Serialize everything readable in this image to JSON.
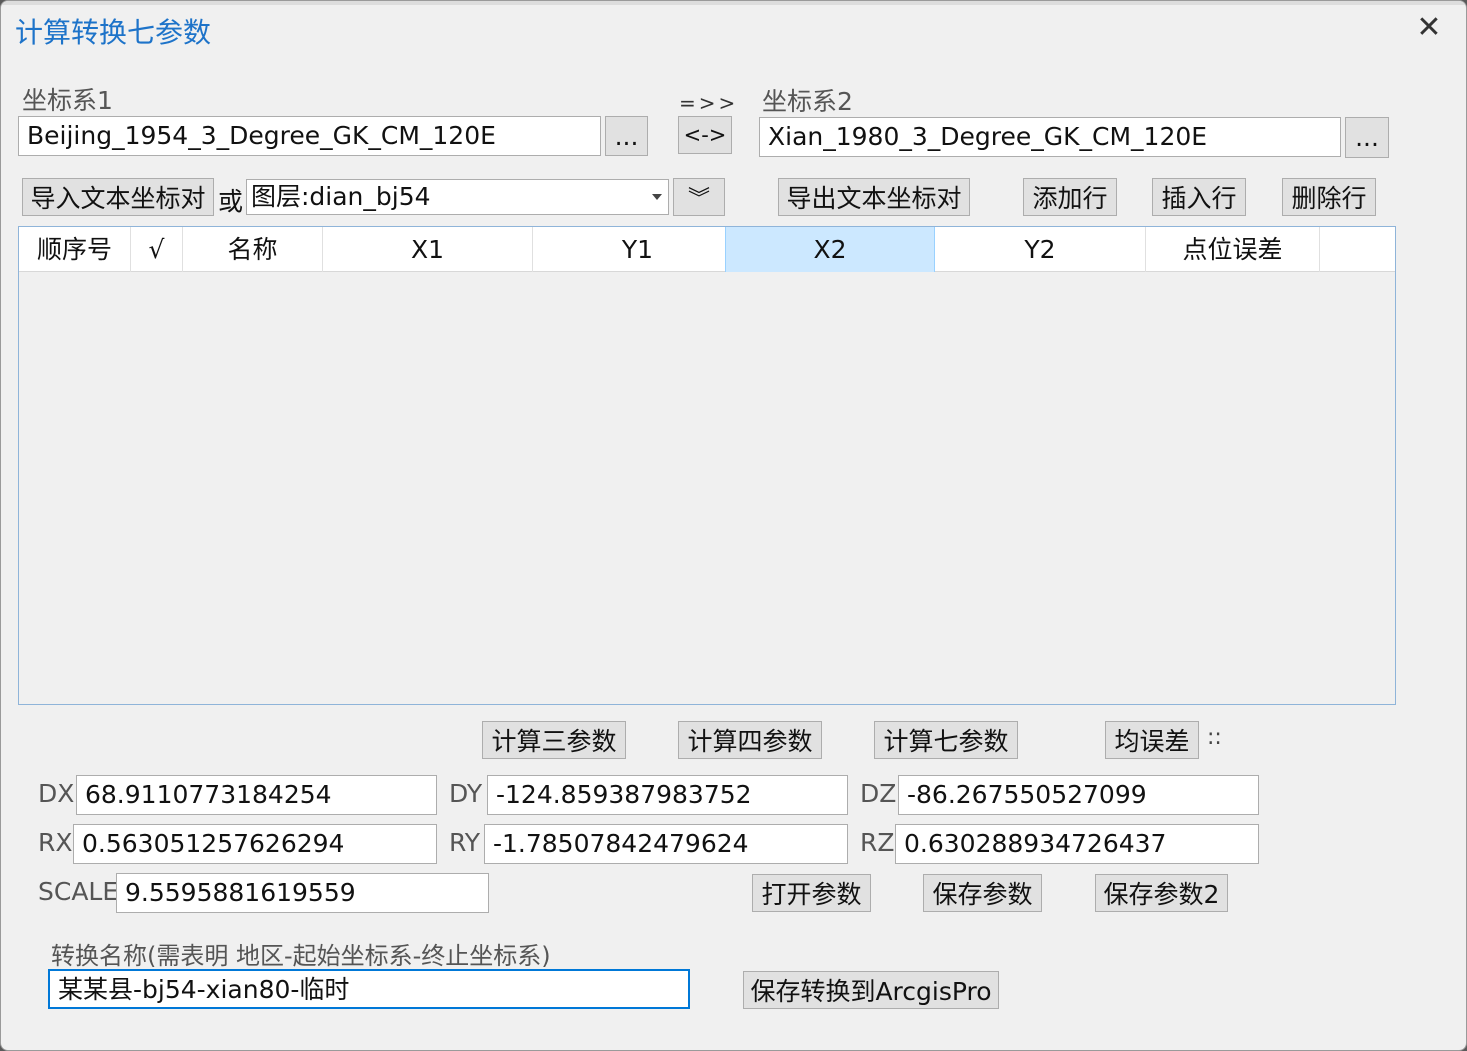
{
  "dialog": {
    "title": "计算转换七参数",
    "close_symbol": "✕"
  },
  "coord1": {
    "label": "坐标系1",
    "value": "Beijing_1954_3_Degree_GK_CM_120E",
    "browse_label": "..."
  },
  "coord2": {
    "label": "坐标系2",
    "value": "Xian_1980_3_Degree_GK_CM_120E",
    "browse_label": "..."
  },
  "swap": {
    "direction_text": "=>>",
    "button_label": "<->"
  },
  "toolbar": {
    "import_label": "导入文本坐标对",
    "or_label": "或",
    "layer_value": "图层:dian_bj54",
    "expand_symbol": "︾",
    "export_label": "导出文本坐标对",
    "add_row_label": "添加行",
    "insert_row_label": "插入行",
    "delete_row_label": "删除行"
  },
  "grid": {
    "columns": [
      "顺序号",
      "√",
      "名称",
      "X1",
      "Y1",
      "X2",
      "Y2",
      "点位误差"
    ],
    "selected_column": "X2",
    "rows": []
  },
  "calc": {
    "three_label": "计算三参数",
    "four_label": "计算四参数",
    "seven_label": "计算七参数",
    "rms_label": "均误差",
    "rms_value": "::"
  },
  "params": {
    "dx_label": "DX",
    "dx": "68.9110773184254",
    "dy_label": "DY",
    "dy": "-124.859387983752",
    "dz_label": "DZ",
    "dz": "-86.267550527099",
    "rx_label": "RX",
    "rx": "0.563051257626294",
    "ry_label": "RY",
    "ry": "-1.78507842479624",
    "rz_label": "RZ",
    "rz": "0.630288934726437",
    "scale_label": "SCALE",
    "scale": "9.5595881619559"
  },
  "param_buttons": {
    "open_label": "打开参数",
    "save_label": "保存参数",
    "save2_label": "保存参数2"
  },
  "transform": {
    "label": "转换名称(需表明 地区-起始坐标系-终止坐标系)",
    "value": "某某县-bj54-xian80-临时",
    "save_label": "保存转换到ArcgisPro"
  }
}
